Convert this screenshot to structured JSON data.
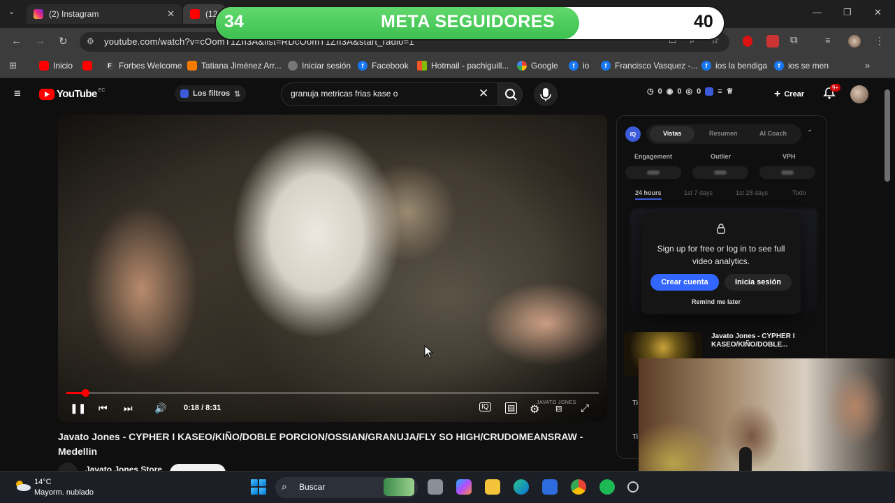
{
  "browser": {
    "tabs": [
      {
        "label": "(2) Instagram",
        "close": "✕"
      },
      {
        "label": "(12"
      }
    ],
    "url": "youtube.com/watch?v=cOomT1ZII3A&list=RDcOomT1ZII3A&start_radio=1",
    "bookmarks": [
      "Inicio",
      "Forbes Welcome",
      "Tatiana Jiménez Arr...",
      "Iniciar sesión",
      "Facebook",
      "Hotmail - pachiguill...",
      "Google",
      "io",
      "Francisco Vasquez -...",
      "ios la bendiga",
      "ios se men"
    ]
  },
  "youtube": {
    "logo_text": "YouTube",
    "logo_country": "EC",
    "filters_label": "Los filtros",
    "search_value": "granuja metricas frias kase o",
    "stats": [
      "0",
      "0",
      "0"
    ],
    "create_label": "Crear",
    "notif_badge": "9+"
  },
  "player": {
    "time": "0:18 / 8:31",
    "progress": 0.035,
    "watermark": "JAVATO JONES",
    "title": "Javato Jones - CYPHER I KASEO/KIÑO/DOBLE PORCION/OSSIAN/GRANUJA/FLY SO HIGH/CRUDOMEANSRAW - Medellin",
    "channel": "Javato Jones Store"
  },
  "analytics": {
    "logo": "IQ",
    "tabs": [
      "Vistas",
      "Resumen",
      "AI Coach"
    ],
    "metrics": [
      "Engagement",
      "Outlier",
      "VPH"
    ],
    "ranges": [
      "24 hours",
      "1st 7 days",
      "1st 28 days",
      "Todo"
    ],
    "signup_text": "Sign up for free or log in to see full video analytics.",
    "create_account": "Crear cuenta",
    "login": "Inicia sesión",
    "remind": "Remind me later",
    "rec_title": "Javato Jones - CYPHER I KASEO/KIÑO/DOBLE...",
    "rec_stub_1": "Ti",
    "rec_stub_2": "Ti"
  },
  "overlay": {
    "current": "34",
    "title": "META SEGUIDORES",
    "goal": "40",
    "fill_color": "#3cc150"
  },
  "taskbar": {
    "temp": "14°C",
    "weather": "Mayorm. nublado",
    "search_placeholder": "Buscar"
  }
}
